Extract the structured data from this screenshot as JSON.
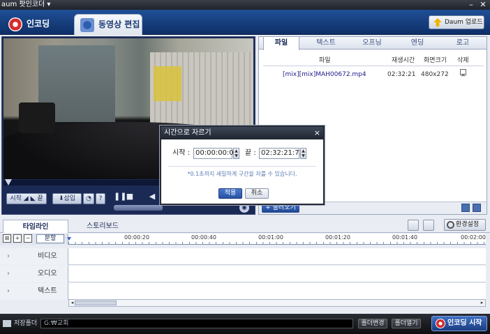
{
  "window": {
    "title": "aum 팟인코더 ▾",
    "min": "–",
    "close": "✕"
  },
  "mode_tabs": {
    "encode": "인코딩",
    "edit": "동영상 편집"
  },
  "upload_button": "Daum 업로드",
  "video_controls": {
    "start": "시작 ◢ ◣ 끝",
    "insert": "⬇삽입",
    "clock": "◔",
    "help": "?",
    "play_pause": "❚❚",
    "stop": "■",
    "prev": "◀",
    "volume_icon": "◉"
  },
  "file_tabs": [
    "파일",
    "텍스트",
    "오프닝",
    "엔딩",
    "로고"
  ],
  "file_table": {
    "headers": [
      "파일",
      "재생시간",
      "화면크기",
      "삭제"
    ],
    "rows": [
      {
        "name": "[mix][mix]MAH00672.mp4",
        "duration": "02:32:21",
        "size": "480x272",
        "delete": "×"
      }
    ]
  },
  "add_file_button": "+ 불러오기",
  "dialog": {
    "title": "시간으로 자르기",
    "close": "×",
    "start_label": "시작 :",
    "start_value": "00:00:00:00",
    "end_label": "끝 :",
    "end_value": "02:32:21:73",
    "hint": "*0.1초까지 세밀하게 구간을 자를 수 있습니다.",
    "ok": "적용",
    "cancel": "취소"
  },
  "timeline": {
    "tabs": [
      "타임라인",
      "스토리보드"
    ],
    "settings_button": "환경설정",
    "split_button": "분할",
    "ticks": [
      "00:00:20",
      "00:00:40",
      "00:01:00",
      "00:01:20",
      "00:01:40",
      "00:02:00"
    ],
    "tracks": [
      "비디오",
      "오디오",
      "텍스트"
    ]
  },
  "bottom_bar": {
    "save_label": "저장폴더",
    "path": "G:₩교회",
    "folder_change": "폴더변경",
    "folder_open": "폴더열기",
    "encode_start": "인코딩 시작"
  }
}
